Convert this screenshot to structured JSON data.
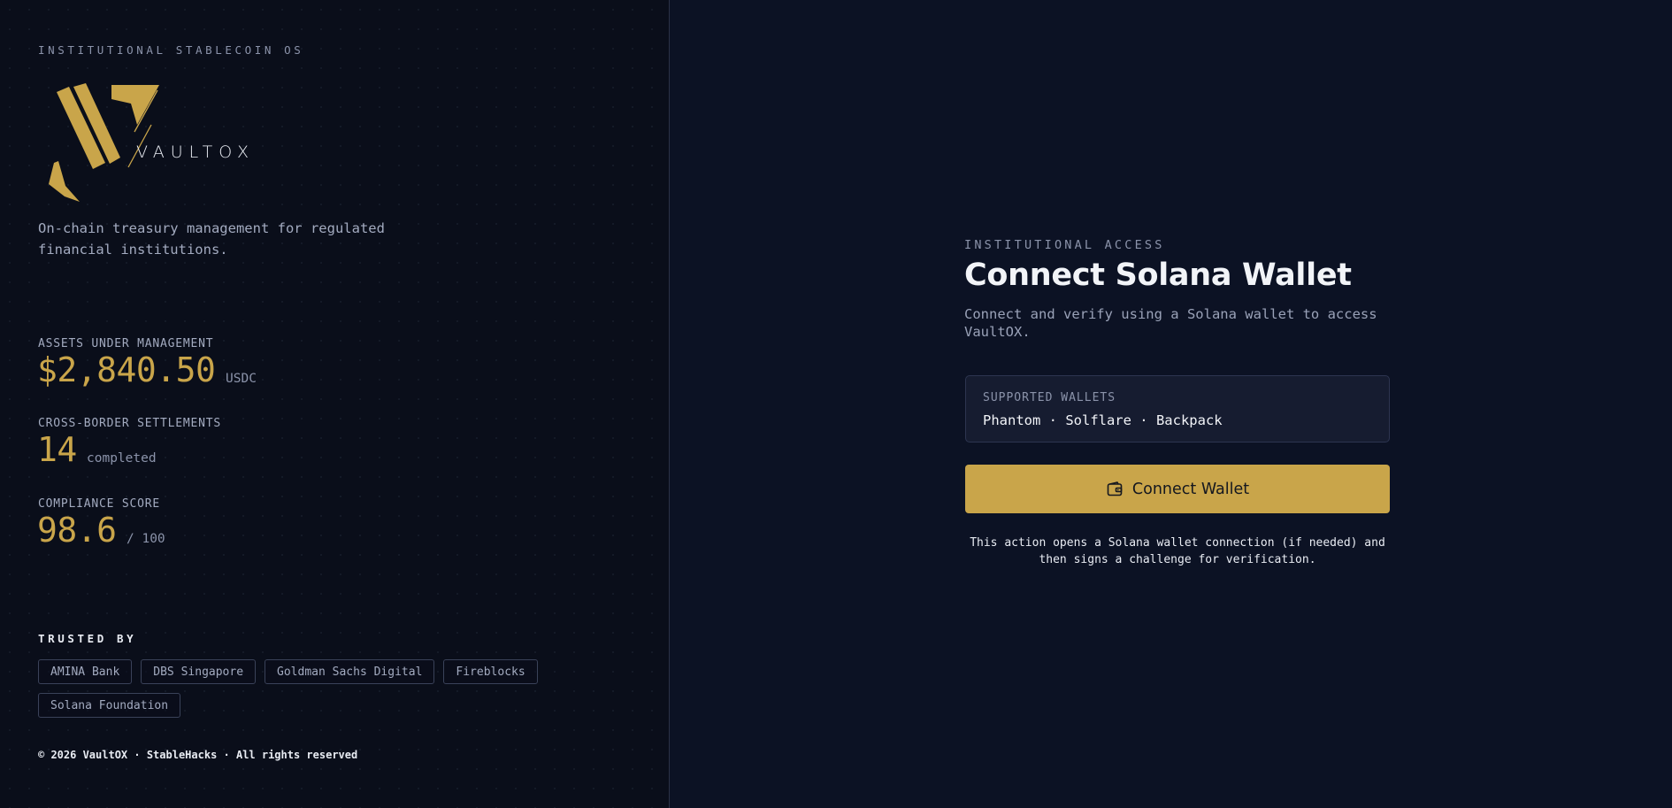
{
  "brand": {
    "eyebrow": "INSTITUTIONAL STABLECOIN OS",
    "logo_text": "VAULTOX",
    "tagline": "On-chain treasury management for regulated financial institutions.",
    "accent_color": "#c9a54a"
  },
  "metrics": [
    {
      "label": "ASSETS UNDER MANAGEMENT",
      "value": "$2,840.50",
      "unit": "USDC"
    },
    {
      "label": "CROSS-BORDER SETTLEMENTS",
      "value": "14",
      "unit": "completed"
    },
    {
      "label": "COMPLIANCE SCORE",
      "value": "98.6",
      "unit": "/ 100"
    }
  ],
  "trusted": {
    "label": "TRUSTED BY",
    "partners": [
      "AMINA Bank",
      "DBS Singapore",
      "Goldman Sachs Digital",
      "Fireblocks",
      "Solana Foundation"
    ]
  },
  "footer": "© 2026 VaultOX · StableHacks · All rights reserved",
  "auth": {
    "eyebrow": "INSTITUTIONAL ACCESS",
    "title": "Connect Solana Wallet",
    "subtitle": "Connect and verify using a Solana wallet to access VaultOX.",
    "supported_label": "SUPPORTED WALLETS",
    "supported_list": "Phantom · Solflare · Backpack",
    "button_label": "Connect Wallet",
    "button_icon": "wallet-icon",
    "note": "This action opens a Solana wallet connection (if needed) and then signs a challenge for verification."
  }
}
